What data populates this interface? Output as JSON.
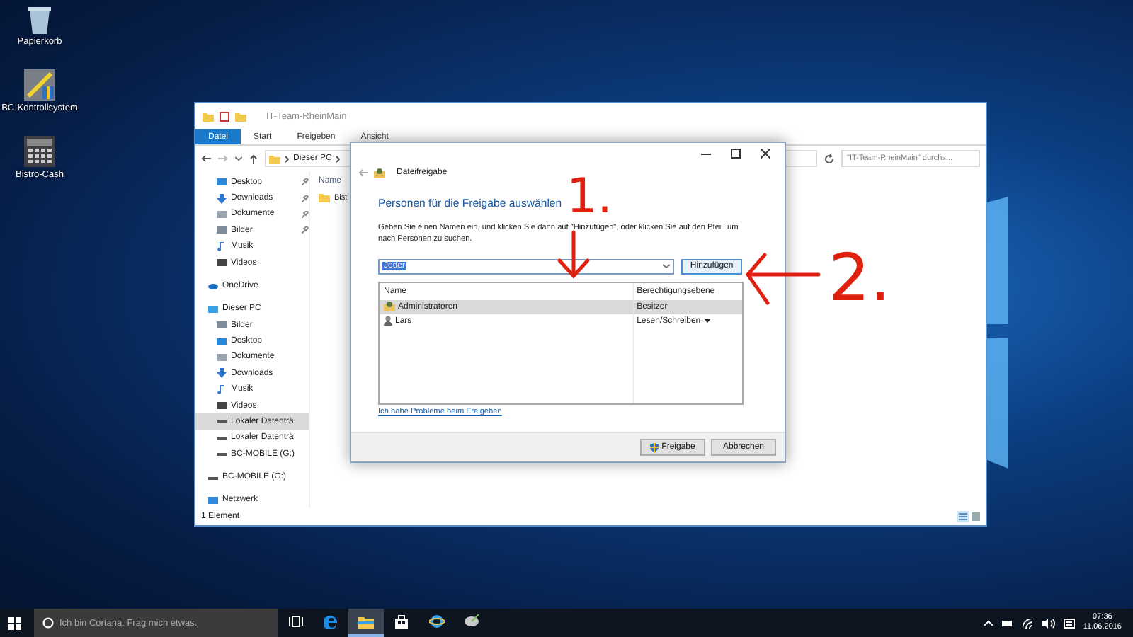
{
  "desktop_icons": [
    {
      "label": "Papierkorb",
      "kind": "bin"
    },
    {
      "label": "BC-Kontrollsystem",
      "kind": "tools"
    },
    {
      "label": "Bistro-Cash",
      "kind": "register"
    }
  ],
  "explorer": {
    "title": "IT-Team-RheinMain",
    "ribbon_tabs": [
      {
        "label": "Datei",
        "selected": true
      },
      {
        "label": "Start",
        "selected": false
      },
      {
        "label": "Freigeben",
        "selected": false
      },
      {
        "label": "Ansicht",
        "selected": false
      }
    ],
    "breadcrumb": "Dieser PC",
    "search": {
      "placeholder": "\"IT-Team-RheinMain\" durchs..."
    },
    "nav": [
      {
        "label": "Desktop",
        "kind": "desktop",
        "pinned": true,
        "selected": false
      },
      {
        "label": "Downloads",
        "kind": "download",
        "pinned": true,
        "selected": false
      },
      {
        "label": "Dokumente",
        "kind": "document",
        "pinned": true,
        "selected": false
      },
      {
        "label": "Bilder",
        "kind": "image",
        "pinned": true,
        "selected": false
      },
      {
        "label": "Musik",
        "kind": "music",
        "pinned": false,
        "selected": false
      },
      {
        "label": "Videos",
        "kind": "video",
        "pinned": false,
        "selected": false
      },
      {
        "label": "OneDrive",
        "kind": "cloud",
        "pinned": false,
        "selected": false
      },
      {
        "label": "Dieser PC",
        "kind": "pc",
        "pinned": false,
        "selected": false
      },
      {
        "label": "Bilder",
        "kind": "image",
        "pinned": false,
        "selected": false
      },
      {
        "label": "Desktop",
        "kind": "desktop",
        "pinned": false,
        "selected": false
      },
      {
        "label": "Dokumente",
        "kind": "document",
        "pinned": false,
        "selected": false
      },
      {
        "label": "Downloads",
        "kind": "download",
        "pinned": false,
        "selected": false
      },
      {
        "label": "Musik",
        "kind": "music",
        "pinned": false,
        "selected": false
      },
      {
        "label": "Videos",
        "kind": "video",
        "pinned": false,
        "selected": false
      },
      {
        "label": "Lokaler Datenträ",
        "kind": "system-drive",
        "pinned": false,
        "selected": true
      },
      {
        "label": "Lokaler Datenträ",
        "kind": "drive",
        "pinned": false,
        "selected": false
      },
      {
        "label": "BC-MOBILE (G:)",
        "kind": "drive",
        "pinned": false,
        "selected": false
      },
      {
        "label": "BC-MOBILE (G:)",
        "kind": "drive-section",
        "pinned": false,
        "selected": false
      },
      {
        "label": "Netzwerk",
        "kind": "network",
        "pinned": false,
        "selected": false
      }
    ],
    "column_header": "Name",
    "files": [
      "Bist"
    ],
    "status": "1 Element"
  },
  "dialog": {
    "title": "Dateifreigabe",
    "heading": "Personen für die Freigabe auswählen",
    "instructions": "Geben Sie einen Namen ein, und klicken Sie dann auf \"Hinzufügen\", oder klicken Sie auf den Pfeil, um nach Personen zu suchen.",
    "name_field": {
      "value": "Jeder"
    },
    "add_button": "Hinzufügen",
    "columns": [
      "Name",
      "Berechtigungsebene"
    ],
    "rows": [
      {
        "name": "Administratoren",
        "permission": "Besitzer",
        "kind": "group",
        "selected": true,
        "has_menu": false
      },
      {
        "name": "Lars",
        "permission": "Lesen/Schreiben",
        "kind": "user",
        "selected": false,
        "has_menu": true
      }
    ],
    "help_link": "Ich habe Probleme beim Freigeben",
    "buttons": [
      {
        "label": "Freigabe",
        "kind": "shield"
      },
      {
        "label": "Abbrechen",
        "kind": "plain"
      }
    ]
  },
  "annotations": [
    {
      "label": "1."
    },
    {
      "label": "2."
    }
  ],
  "taskbar": {
    "search": {
      "placeholder": "Ich bin Cortana. Frag mich etwas."
    },
    "apps": [
      {
        "kind": "task-view",
        "active": false
      },
      {
        "kind": "edge",
        "active": false
      },
      {
        "kind": "explorer",
        "active": true
      },
      {
        "kind": "store",
        "active": false
      },
      {
        "kind": "ie",
        "active": false
      },
      {
        "kind": "app",
        "active": false
      }
    ],
    "time": "07:36",
    "date": "11.06.2016"
  }
}
